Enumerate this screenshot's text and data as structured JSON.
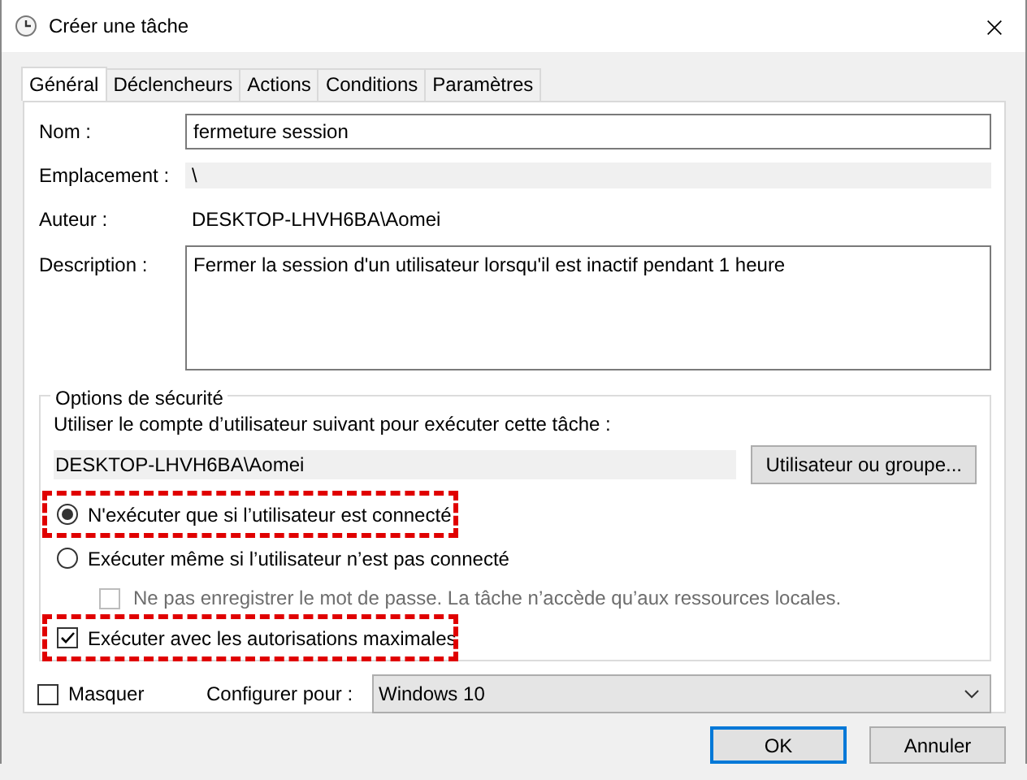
{
  "window": {
    "title": "Créer une tâche"
  },
  "tabs": [
    {
      "label": "Général",
      "selected": true
    },
    {
      "label": "Déclencheurs",
      "selected": false
    },
    {
      "label": "Actions",
      "selected": false
    },
    {
      "label": "Conditions",
      "selected": false
    },
    {
      "label": "Paramètres",
      "selected": false
    }
  ],
  "fields": [
    {
      "label": "Nom :",
      "kind": "input",
      "value": "fermeture session"
    },
    {
      "label": "Emplacement :",
      "kind": "readonly",
      "value": "\\"
    },
    {
      "label": "Auteur :",
      "kind": "text",
      "value": "DESKTOP-LHVH6BA\\Aomei"
    },
    {
      "label": "Description :",
      "kind": "textarea",
      "value": "Fermer la session d'un utilisateur lorsqu'il est inactif pendant 1 heure"
    }
  ],
  "security": {
    "title": "Options de sécurité",
    "prompt": "Utiliser le compte d’utilisateur suivant pour exécuter cette tâche :",
    "account": "DESKTOP-LHVH6BA\\Aomei",
    "account_button": "Utilisateur ou groupe...",
    "options": [
      {
        "kind": "radio",
        "label": "N'exécuter que si l’utilisateur est connecté",
        "selected": true,
        "highlighted": true,
        "indented": false,
        "disabled": false
      },
      {
        "kind": "radio",
        "label": "Exécuter même si l’utilisateur n’est pas connecté",
        "selected": false,
        "highlighted": false,
        "indented": false,
        "disabled": false
      },
      {
        "kind": "checkbox",
        "label": "Ne pas enregistrer le mot de passe. La tâche n’accède qu’aux ressources locales.",
        "checked": false,
        "highlighted": false,
        "indented": true,
        "disabled": true
      },
      {
        "kind": "checkbox",
        "label": "Exécuter avec les autorisations maximales",
        "checked": true,
        "highlighted": true,
        "indented": false,
        "disabled": false
      }
    ]
  },
  "hidden": {
    "label": "Masquer",
    "checked": false
  },
  "configure": {
    "label": "Configurer pour :",
    "value": "Windows 10"
  },
  "buttons": [
    {
      "label": "OK",
      "default": true
    },
    {
      "label": "Annuler",
      "default": false
    }
  ]
}
